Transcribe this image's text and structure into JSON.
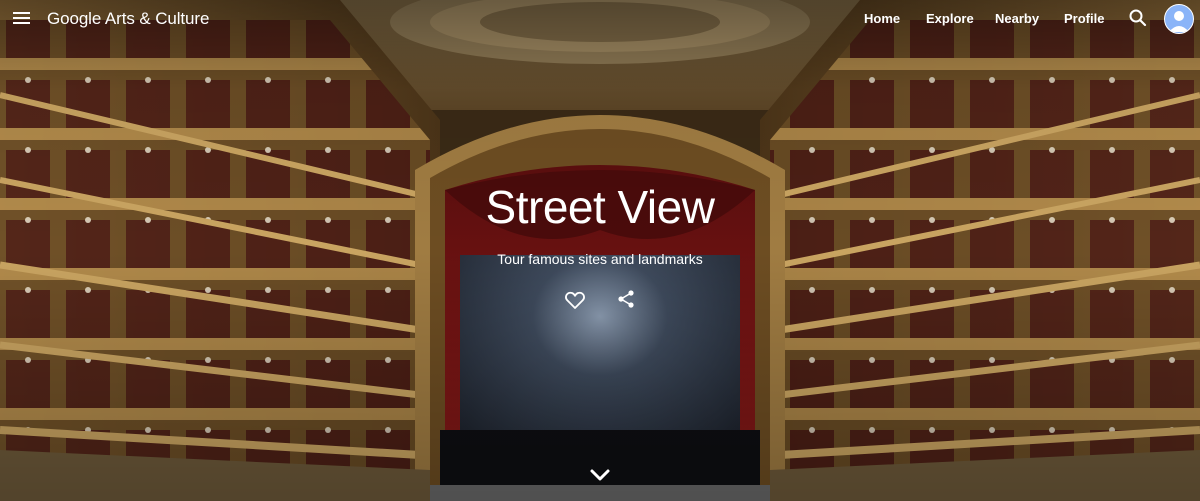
{
  "header": {
    "logo_text": "Google Arts & Culture",
    "nav": [
      {
        "label": "Home"
      },
      {
        "label": "Explore"
      },
      {
        "label": "Nearby"
      },
      {
        "label": "Profile"
      }
    ],
    "icons": {
      "menu": "menu-icon",
      "search": "search-icon",
      "avatar": "avatar-icon"
    }
  },
  "hero": {
    "title": "Street View",
    "subtitle": "Tour famous sites and landmarks",
    "icons": {
      "like": "heart-icon",
      "share": "share-icon",
      "scroll": "chevron-down-icon"
    }
  },
  "colors": {
    "text": "#ffffff",
    "avatar_bg": "#8ab4f8",
    "curtain": "#7a1414",
    "gold": "#b8904e",
    "stage": "#3a4252"
  }
}
